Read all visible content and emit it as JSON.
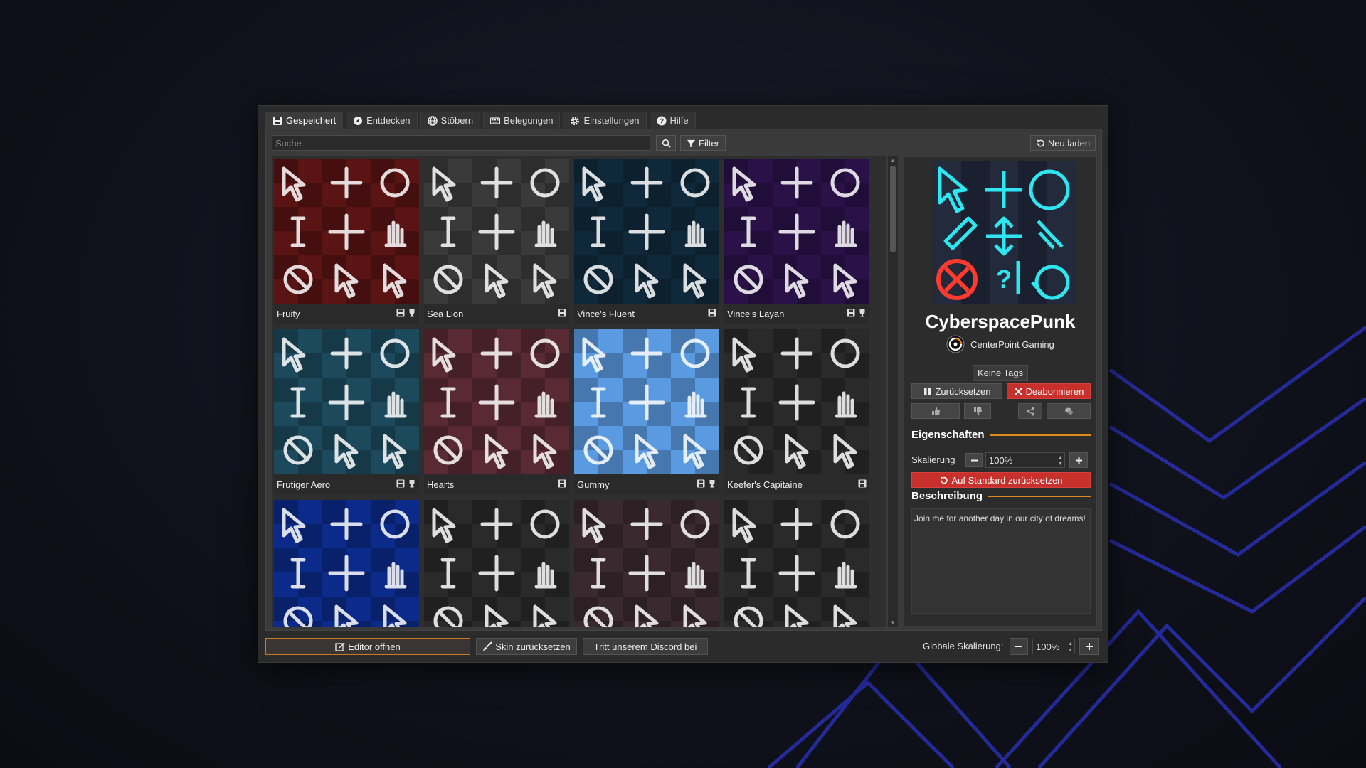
{
  "tabs": [
    {
      "label": "Gespeichert",
      "icon": "save-icon",
      "active": true
    },
    {
      "label": "Entdecken",
      "icon": "compass-icon"
    },
    {
      "label": "Stöbern",
      "icon": "globe-icon"
    },
    {
      "label": "Belegungen",
      "icon": "keyboard-icon"
    },
    {
      "label": "Einstellungen",
      "icon": "gear-icon"
    },
    {
      "label": "Hilfe",
      "icon": "help-icon"
    }
  ],
  "toolbar": {
    "search_placeholder": "Suche",
    "filter_label": "Filter",
    "reload_label": "Neu laden"
  },
  "skins": [
    {
      "name": "Fruity",
      "trophy": true,
      "bg": "#5a1414"
    },
    {
      "name": "Sea Lion",
      "trophy": false,
      "bg": "#3a3a3a"
    },
    {
      "name": "Vince's Fluent",
      "trophy": false,
      "bg": "#10293a"
    },
    {
      "name": "Vince's Layan",
      "trophy": true,
      "bg": "#2a1248"
    },
    {
      "name": "Frutiger Aero",
      "trophy": true,
      "bg": "#1c4a5c"
    },
    {
      "name": "Hearts",
      "trophy": false,
      "bg": "#5a2a34"
    },
    {
      "name": "Gummy",
      "trophy": true,
      "bg": "#5a9ae0"
    },
    {
      "name": "Keefer's Capitaine",
      "trophy": false,
      "bg": "#2a2a2a"
    },
    {
      "name": "",
      "trophy": false,
      "bg": "#0c2a8a"
    },
    {
      "name": "",
      "trophy": false,
      "bg": "#2a2a2a"
    },
    {
      "name": "",
      "trophy": false,
      "bg": "#3a2a30"
    },
    {
      "name": "",
      "trophy": false,
      "bg": "#2a2a2a"
    }
  ],
  "detail": {
    "title": "CyberspacePunk",
    "author": "CenterPoint Gaming",
    "tags": "Keine Tags",
    "reset_label": "Zurücksetzen",
    "unsubscribe_label": "Deabonnieren",
    "properties_heading": "Eigenschaften",
    "scaling_label": "Skalierung",
    "scaling_value": "100%",
    "reset_default_label": "Auf Standard zurücksetzen",
    "description_heading": "Beschreibung",
    "description": "Join me for another day in our city of dreams!"
  },
  "bottom": {
    "editor_label": "Editor öffnen",
    "reset_skin_label": "Skin zurücksetzen",
    "discord_label": "Tritt unserem Discord bei",
    "global_scaling_label": "Globale Skalierung:",
    "global_scaling_value": "100%"
  },
  "colors": {
    "accent_orange": "#e08a1e",
    "danger_red": "#c8302c",
    "cyber_cyan": "#2ee6f0"
  }
}
